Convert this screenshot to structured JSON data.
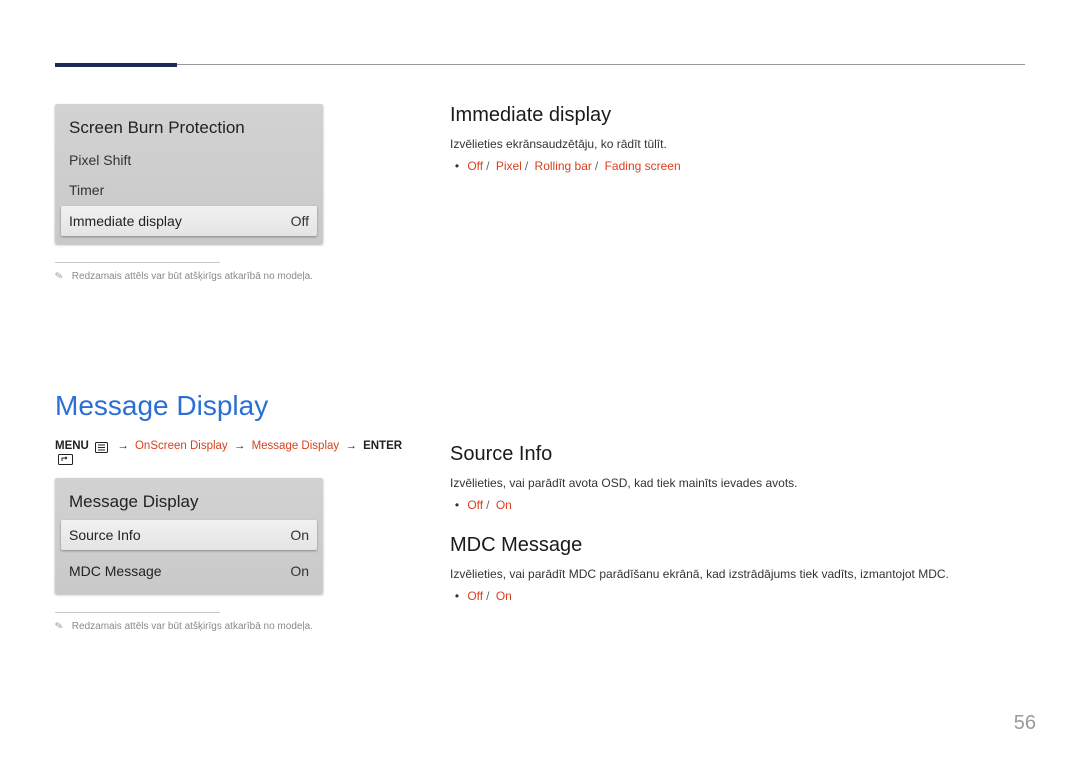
{
  "page_number": "56",
  "left": {
    "panel_sbp": {
      "title": "Screen Burn Protection",
      "item_pixel_shift": "Pixel Shift",
      "item_timer": "Timer",
      "item_immediate": "Immediate display",
      "val_immediate": "Off"
    },
    "note1": "Redzamais attēls var būt atšķirīgs atkarībā no modeļa.",
    "h_message_display": "Message Display",
    "crumb": {
      "menu": "MENU",
      "p1": "OnScreen Display",
      "p2": "Message Display",
      "enter": "ENTER"
    },
    "panel_md": {
      "title": "Message Display",
      "item_src": "Source Info",
      "val_src": "On",
      "item_mdc": "MDC Message",
      "val_mdc": "On"
    },
    "note2": "Redzamais attēls var būt atšķirīgs atkarībā no modeļa."
  },
  "right": {
    "immediate": {
      "title": "Immediate display",
      "desc": "Izvēlieties ekrānsaudzētāju, ko rādīt tūlīt.",
      "opt1": "Off",
      "opt2": "Pixel",
      "opt3": "Rolling bar",
      "opt4": "Fading screen"
    },
    "source": {
      "title": "Source Info",
      "desc": "Izvēlieties, vai parādīt avota OSD, kad tiek mainīts ievades avots.",
      "opt1": "Off",
      "opt2": "On"
    },
    "mdc": {
      "title": "MDC Message",
      "desc": "Izvēlieties, vai parādīt MDC parādīšanu ekrānā, kad izstrādājums tiek vadīts, izmantojot MDC.",
      "opt1": "Off",
      "opt2": "On"
    }
  }
}
